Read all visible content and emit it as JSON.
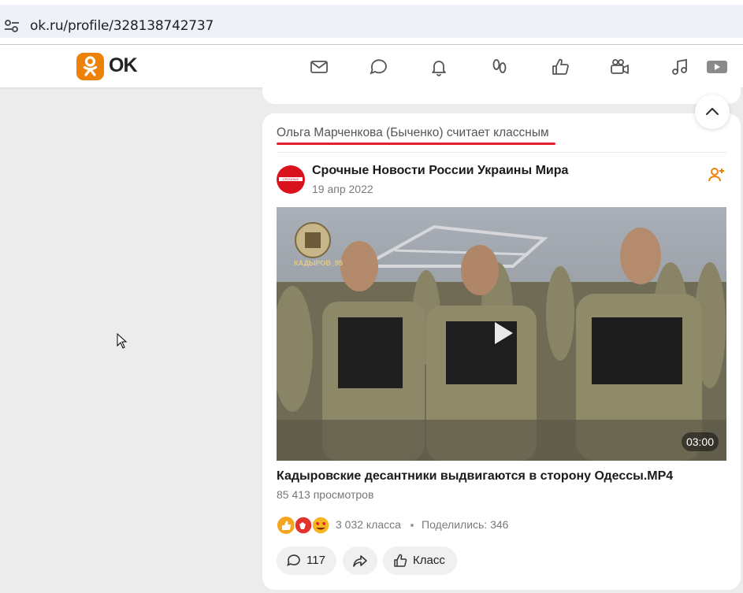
{
  "browser": {
    "url": "ok.ru/profile/328138742737",
    "icons": [
      "site-settings-icon"
    ]
  },
  "site": {
    "logo_text": "OK",
    "brand_color": "#ee8208",
    "nav_icons": [
      "mail-icon",
      "chat-icon",
      "bell-icon",
      "guests-icon",
      "like-icon",
      "video-camera-icon",
      "music-icon",
      "video-tab-icon"
    ]
  },
  "post": {
    "liked_by_text": "Ольга Марченкова (Быченко) считает классным",
    "group_name": "Срочные Новости России Украины Мира",
    "avatar_text": "СРОЧНЫЕ НОВОСТИ",
    "date": "19 апр 2022",
    "video": {
      "watermark_text": "КАДЫРОВ_95",
      "duration": "03:00",
      "title": "Кадыровские десантники выдвигаются в сторону Одессы.MP4",
      "views": "85 413 просмотров"
    },
    "reactions_count": "3 032 класса",
    "shares": "Поделились: 346",
    "comments_count": "117",
    "class_label": "Класс",
    "accent_color": "#e0202a"
  }
}
